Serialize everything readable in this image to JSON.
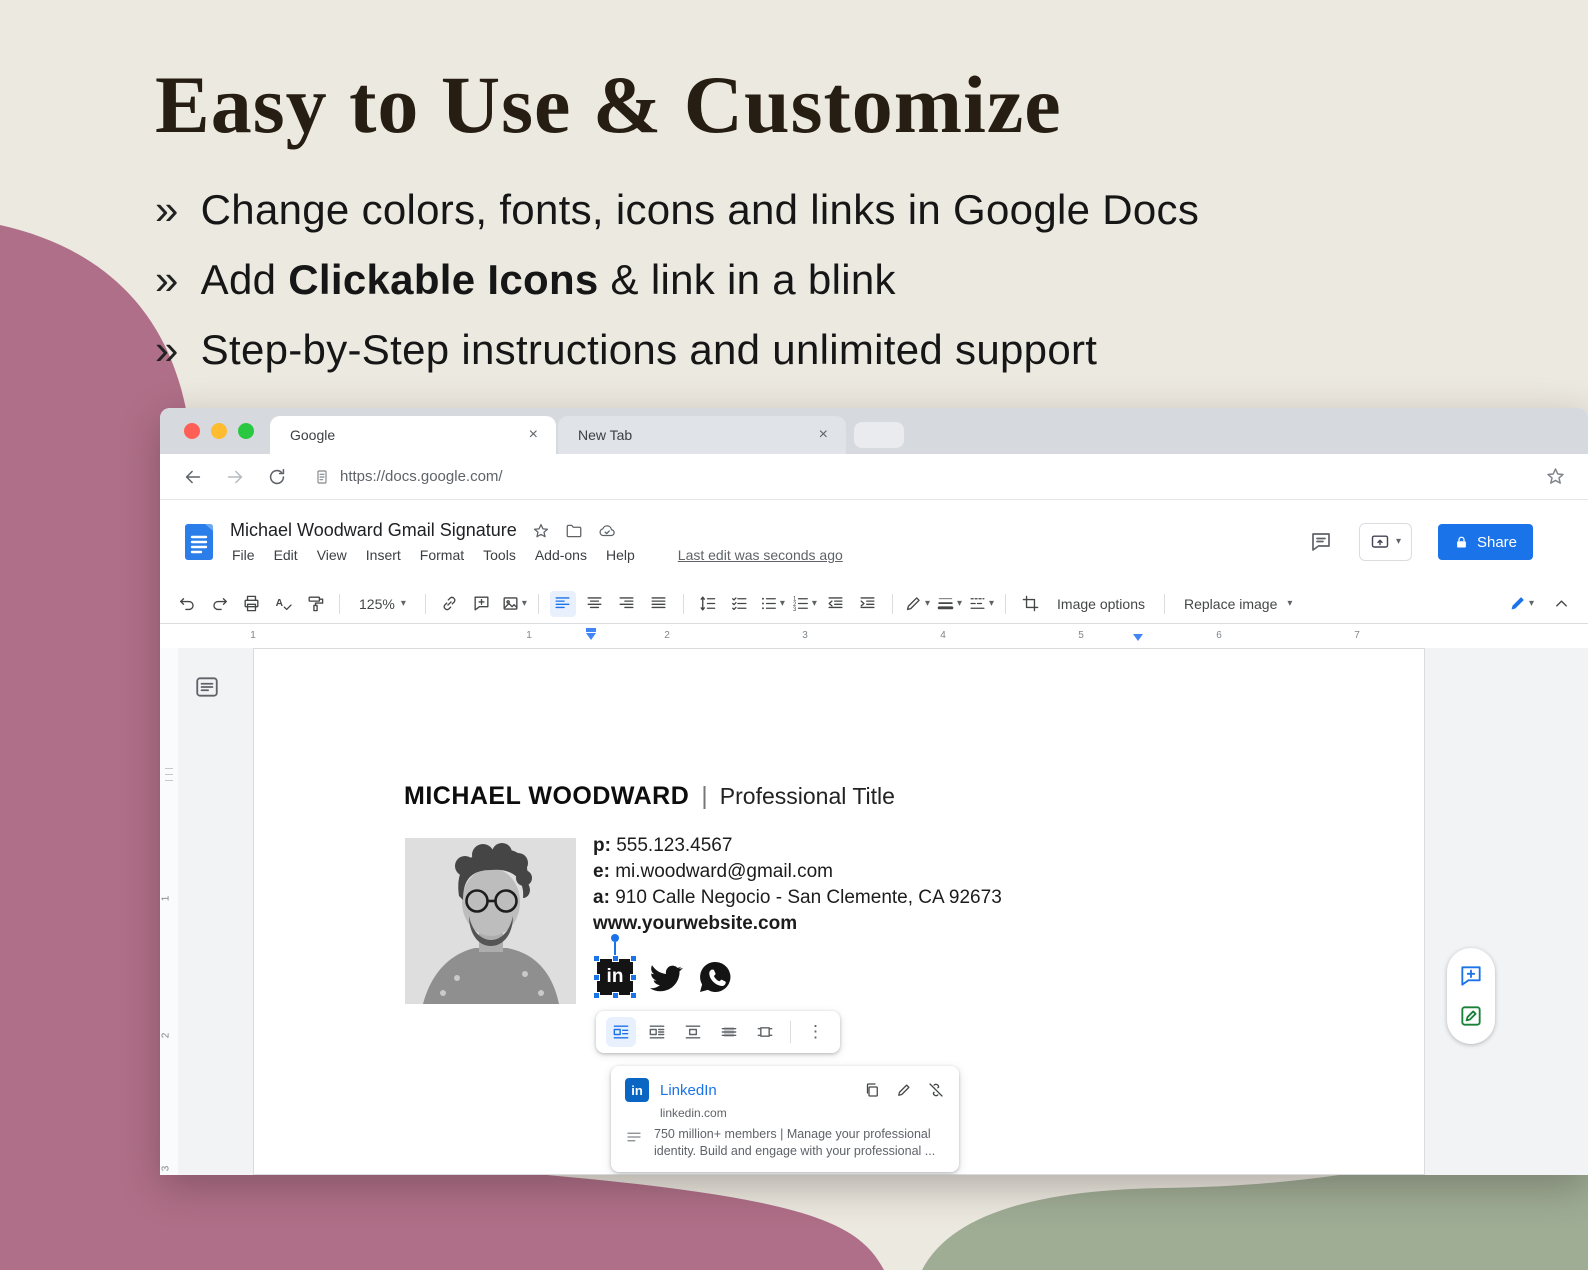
{
  "colors": {
    "background": "#ece9e0",
    "mauve_blob": "#b06f88",
    "sage_blob": "#9fad95",
    "accent_blue": "#1a73e8",
    "linkedin_blue": "#0a66c2",
    "heading_text": "#261d13"
  },
  "hero": {
    "title": "Easy to Use & Customize",
    "bullets": [
      {
        "marker": "»",
        "before": "Change colors, fonts, icons and links in Google Docs",
        "bold": "",
        "after": ""
      },
      {
        "marker": "»",
        "before": "Add ",
        "bold": "Clickable Icons",
        "after": " & link in a blink"
      },
      {
        "marker": "»",
        "before": "Step-by-Step instructions and unlimited support",
        "bold": "",
        "after": ""
      }
    ]
  },
  "browser": {
    "tabs": [
      {
        "title": "Google"
      },
      {
        "title": "New Tab"
      }
    ],
    "url": "https://docs.google.com/"
  },
  "icons": {
    "close": "×",
    "caret": "▾",
    "more_vertical": "⋮"
  },
  "docs": {
    "doc_title": "Michael Woodward Gmail Signature",
    "menus": [
      "File",
      "Edit",
      "View",
      "Insert",
      "Format",
      "Tools",
      "Add-ons",
      "Help"
    ],
    "last_edit": "Last edit was seconds ago",
    "share": "Share",
    "zoom": "125%",
    "image_options": "Image options",
    "replace_image": "Replace image",
    "ruler_top": [
      "1",
      "1",
      "2",
      "3",
      "4",
      "5",
      "6",
      "7"
    ],
    "ruler_side": [
      "1",
      "2",
      "3"
    ]
  },
  "signature": {
    "name": "MICHAEL WOODWARD",
    "separator": "|",
    "role": "Professional Title",
    "phone_label": "p:",
    "phone": "555.123.4567",
    "email_label": "e:",
    "email": "mi.woodward@gmail.com",
    "address_label": "a:",
    "address": "910 Calle Negocio - San Clemente, CA 92673",
    "website": "www.yourwebsite.com",
    "linkedin_glyph": "in"
  },
  "link_card": {
    "title": "LinkedIn",
    "url": "linkedin.com",
    "description": "750 million+ members | Manage your professional identity. Build and engage with your professional ..."
  }
}
